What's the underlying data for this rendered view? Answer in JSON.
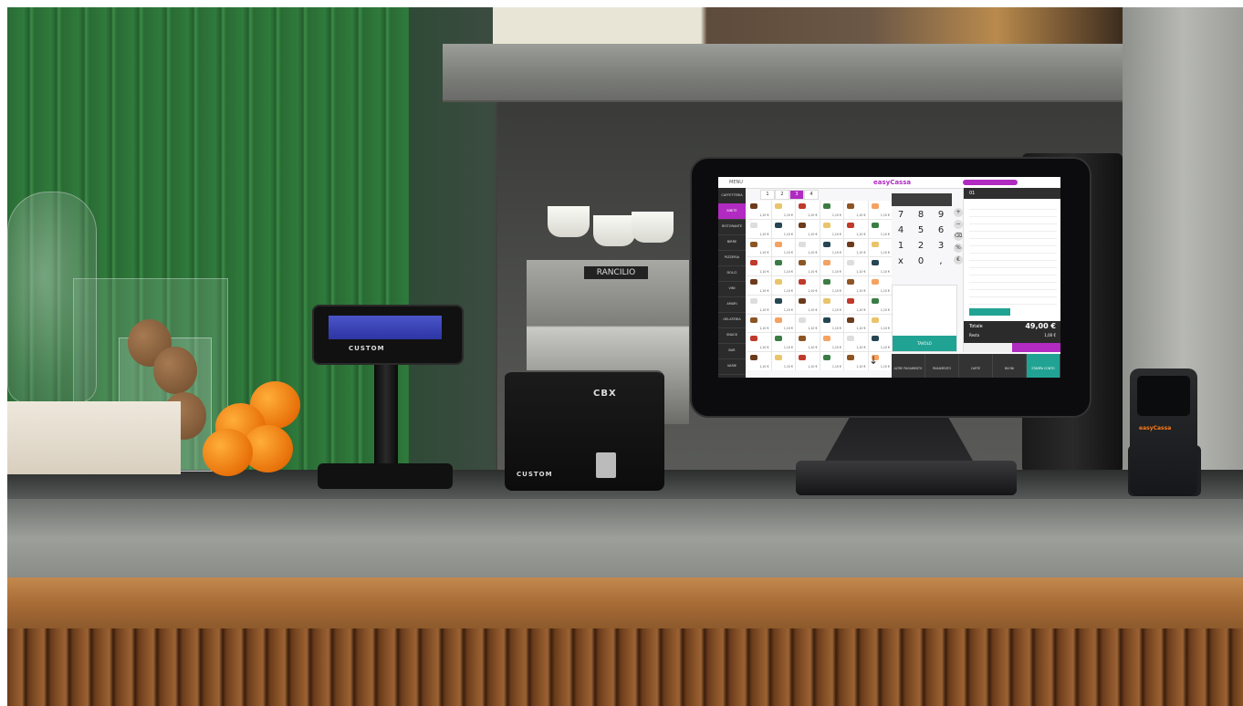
{
  "scene": {
    "description_free": true
  },
  "devices": {
    "customer_display": {
      "brand": "CUSTOM"
    },
    "printer": {
      "brand": "CUSTOM",
      "logo": "CBX"
    },
    "espresso_machine": {
      "brand": "RANCILIO"
    },
    "handheld": {
      "brand": "easyCassa"
    }
  },
  "pos_screen": {
    "app_logo": "easyCassa",
    "menu_label": "MENU",
    "header_pill": "",
    "tabs": [
      "1",
      "2",
      "3",
      "4"
    ],
    "active_tab_index": 2,
    "sidebar_items": [
      "CAFFETTERIA",
      "BIBITE",
      "RISTORANTE",
      "BIRRE",
      "PIZZERIA",
      "DOLCI",
      "VINI",
      "AMARI",
      "GELATERIA",
      "SNACK",
      "BAR",
      "VARIE"
    ],
    "active_sidebar_index": 1,
    "product_price": "1,10 €",
    "numpad_keys": [
      "7",
      "8",
      "9",
      "4",
      "5",
      "6",
      "1",
      "2",
      "3",
      "x",
      "0",
      ","
    ],
    "table_label": "01",
    "mid_button": "TAVOLO",
    "bottom_bar": [
      "ALTRE PAGAMENTO",
      "PAGAMENTO",
      "CARTE",
      "BUONI",
      "STAMPA CONTO"
    ],
    "receipt_total_label": "Totale",
    "receipt_total_value": "49,00 €",
    "receipt_rest_label": "Resto",
    "receipt_rest_value": "1,00 €",
    "accent_color": "#b12ac2",
    "teal_color": "#21a394"
  }
}
